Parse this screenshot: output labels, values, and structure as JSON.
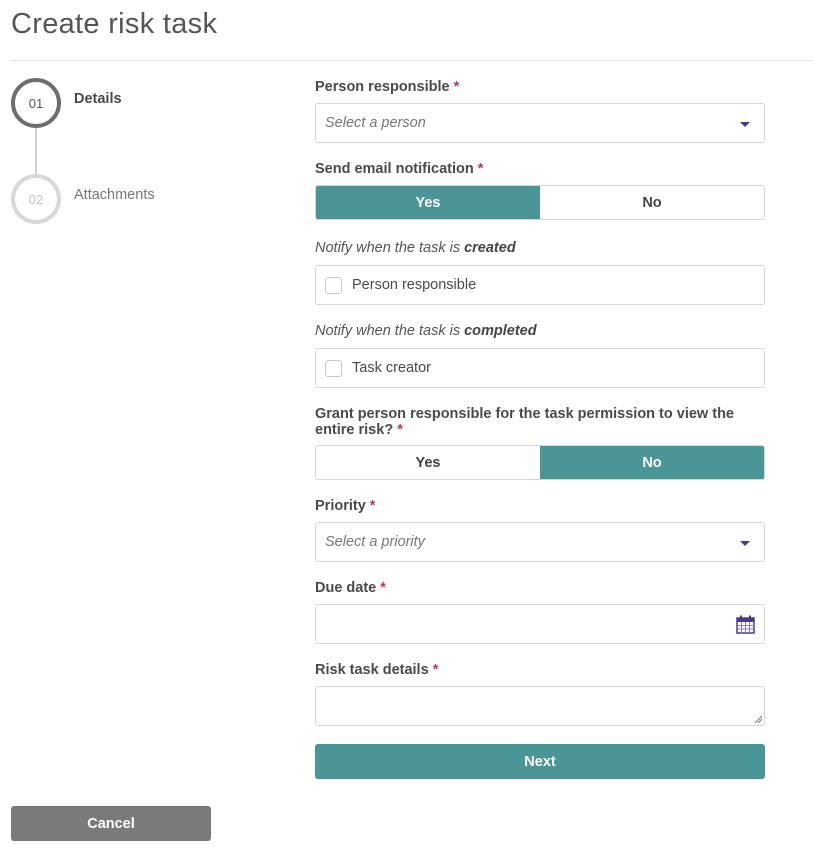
{
  "page": {
    "title": "Create risk task"
  },
  "stepper": {
    "steps": [
      {
        "number": "01",
        "label": "Details",
        "state": "active"
      },
      {
        "number": "02",
        "label": "Attachments",
        "state": "inactive"
      }
    ]
  },
  "form": {
    "required_marker": "*",
    "person_responsible": {
      "label": "Person responsible",
      "placeholder": "Select a person"
    },
    "send_email": {
      "label": "Send email notification",
      "options": [
        "Yes",
        "No"
      ],
      "selected": "Yes"
    },
    "notify_created": {
      "prefix": "Notify when the task is ",
      "emphasis": "created",
      "checkbox_label": "Person responsible",
      "checked": false
    },
    "notify_completed": {
      "prefix": "Notify when the task is ",
      "emphasis": "completed",
      "checkbox_label": "Task creator",
      "checked": false
    },
    "grant_permission": {
      "label": "Grant person responsible for the task permission to view the entire risk?",
      "options": [
        "Yes",
        "No"
      ],
      "selected": "No"
    },
    "priority": {
      "label": "Priority",
      "placeholder": "Select a priority"
    },
    "due_date": {
      "label": "Due date",
      "value": ""
    },
    "details": {
      "label": "Risk task details",
      "value": ""
    }
  },
  "actions": {
    "next_label": "Next",
    "cancel_label": "Cancel"
  },
  "colors": {
    "accent": "#4a9595",
    "required": "#b0396e",
    "icon": "#4b3a8c",
    "cancel": "#7a7a7a"
  }
}
